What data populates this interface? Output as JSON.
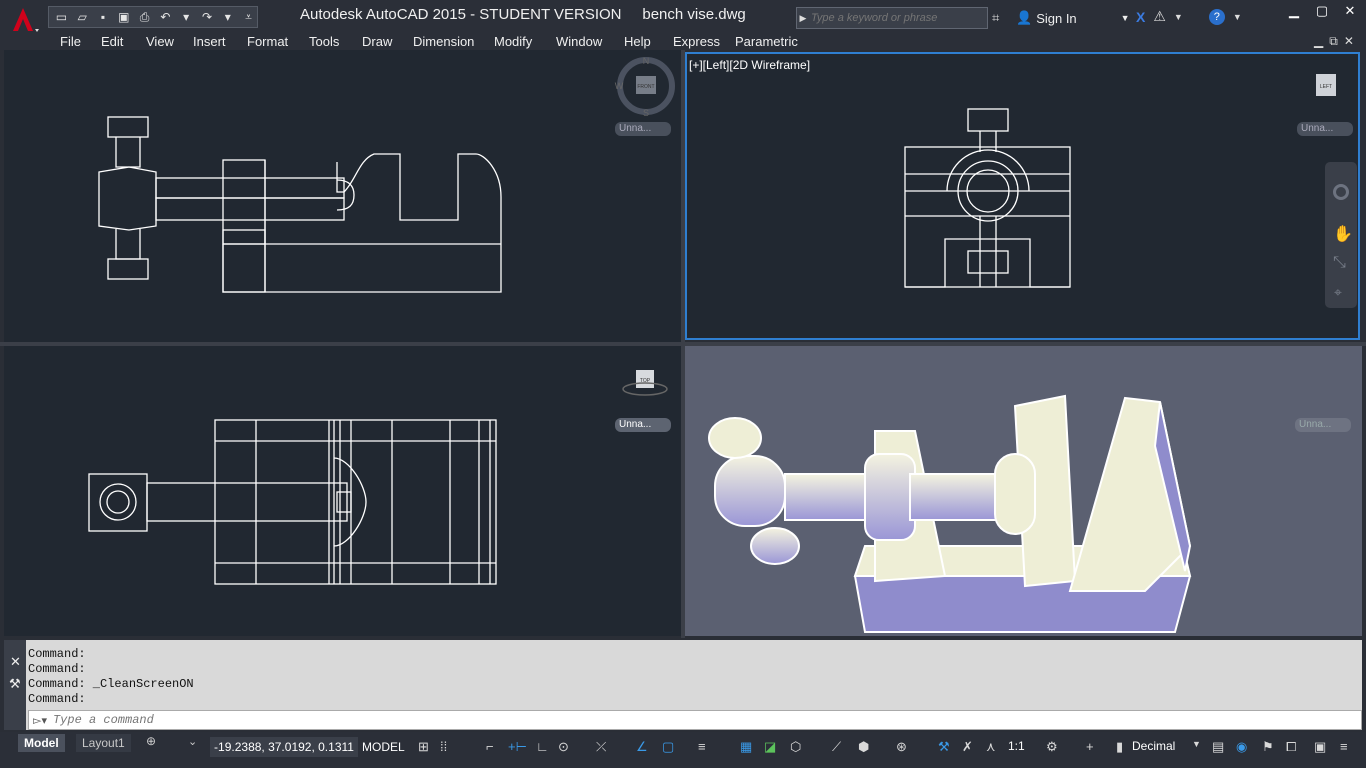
{
  "title_bar": {
    "app_title": "Autodesk AutoCAD 2015 - STUDENT VERSION",
    "doc_title": "bench vise.dwg",
    "search_placeholder": "Type a keyword or phrase",
    "sign_in": "Sign In"
  },
  "menu": [
    "File",
    "Edit",
    "View",
    "Insert",
    "Format",
    "Tools",
    "Draw",
    "Dimension",
    "Modify",
    "Window",
    "Help",
    "Express",
    "Parametric"
  ],
  "viewports": {
    "top_right_label": "[+][Left][2D Wireframe]",
    "named_view": "Unna...",
    "cube_labels": {
      "front": "FRONT",
      "left": "LEFT",
      "top": "TOP"
    },
    "compass": {
      "n": "N",
      "s": "S",
      "w": "W"
    }
  },
  "command": {
    "history": [
      "Command:",
      "Command:",
      "Command: _CleanScreenON",
      "Command:"
    ],
    "placeholder": "Type a command"
  },
  "status": {
    "tabs": [
      "Model",
      "Layout1"
    ],
    "coordinates": "-19.2388, 37.0192, 0.1311",
    "model": "MODEL",
    "scale": "1:1",
    "units": "Decimal"
  },
  "colors": {
    "accent": "#2f7fd1",
    "viewport_bg": "#212831",
    "shaded_bg": "#5b6071",
    "logo": "#d0021b"
  }
}
